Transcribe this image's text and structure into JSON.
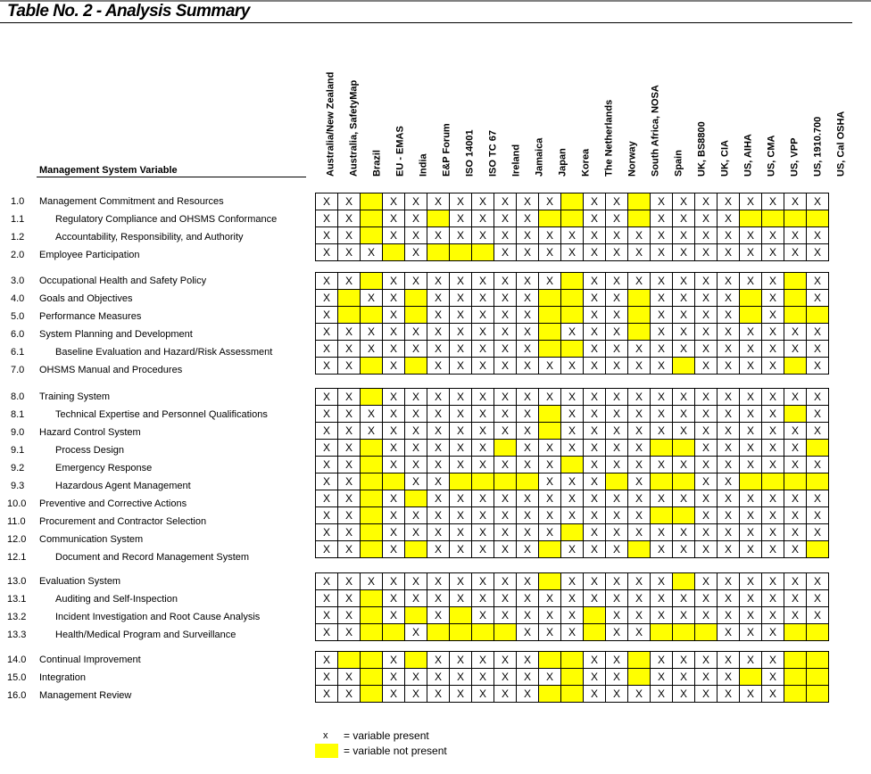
{
  "title": "Table No. 2 - Analysis Summary",
  "variable_heading": "Management System Variable",
  "present_mark": "X",
  "colors": {
    "not_present": "#ffff00",
    "present_bg": "#ffffff"
  },
  "columns": [
    "Australia/New Zealand",
    "Australia, SafetyMap",
    "Brazil",
    "EU - EMAS",
    "India",
    "E&P Forum",
    "ISO 14001",
    "ISO TC 67",
    "Ireland",
    "Jamaica",
    "Japan",
    "Korea",
    "The Netherlands",
    "Norway",
    "South Africa, NOSA",
    "Spain",
    "UK, BS8800",
    "UK, CIA",
    "US, AIHA",
    "US, CMA",
    "US, VPP",
    "US, 1910.700",
    "US, Cal OSHA"
  ],
  "groups": [
    {
      "rows": [
        {
          "num": "1.0",
          "label": "Management Commitment and Resources",
          "indent": false,
          "not_present": [
            2,
            11,
            14
          ]
        },
        {
          "num": "1.1",
          "label": "Regulatory Compliance and OHSMS Conformance",
          "indent": true,
          "not_present": [
            2,
            5,
            10,
            11,
            14,
            19,
            20,
            21,
            22
          ]
        },
        {
          "num": "1.2",
          "label": "Accountability, Responsibility, and Authority",
          "indent": true,
          "not_present": [
            2
          ]
        },
        {
          "num": "2.0",
          "label": "Employee Participation",
          "indent": false,
          "not_present": [
            3,
            5,
            6,
            7
          ]
        }
      ]
    },
    {
      "rows": [
        {
          "num": "3.0",
          "label": "Occupational Health and Safety Policy",
          "indent": false,
          "not_present": [
            2,
            11,
            21
          ]
        },
        {
          "num": "4.0",
          "label": "Goals and Objectives",
          "indent": false,
          "not_present": [
            1,
            4,
            10,
            11,
            14,
            19,
            21
          ]
        },
        {
          "num": "5.0",
          "label": "Performance Measures",
          "indent": false,
          "not_present": [
            1,
            2,
            4,
            10,
            11,
            14,
            19,
            21,
            22
          ]
        },
        {
          "num": "6.0",
          "label": "System Planning and Development",
          "indent": false,
          "not_present": [
            10,
            14
          ]
        },
        {
          "num": "6.1",
          "label": "Baseline Evaluation and Hazard/Risk Assessment",
          "indent": true,
          "not_present": [
            10,
            11
          ]
        },
        {
          "num": "7.0",
          "label": "OHSMS Manual and Procedures",
          "indent": false,
          "not_present": [
            2,
            4,
            16,
            21
          ]
        }
      ]
    },
    {
      "rows": [
        {
          "num": "8.0",
          "label": "Training System",
          "indent": false,
          "not_present": [
            2
          ]
        },
        {
          "num": "8.1",
          "label": "Technical Expertise and Personnel Qualifications",
          "indent": true,
          "not_present": [
            10,
            21
          ]
        },
        {
          "num": "9.0",
          "label": "Hazard Control System",
          "indent": false,
          "not_present": [
            10
          ]
        },
        {
          "num": "9.1",
          "label": "Process Design",
          "indent": true,
          "not_present": [
            2,
            8,
            15,
            16,
            22
          ]
        },
        {
          "num": "9.2",
          "label": "Emergency Response",
          "indent": true,
          "not_present": [
            2,
            11
          ]
        },
        {
          "num": "9.3",
          "label": "Hazardous Agent Management",
          "indent": true,
          "not_present": [
            2,
            3,
            6,
            7,
            8,
            9,
            13,
            15,
            16,
            19,
            20,
            21,
            22
          ]
        },
        {
          "num": "10.0",
          "label": "Preventive and Corrective Actions",
          "indent": false,
          "not_present": [
            2,
            4
          ]
        },
        {
          "num": "11.0",
          "label": "Procurement and Contractor Selection",
          "indent": false,
          "not_present": [
            2,
            15,
            16
          ]
        },
        {
          "num": "12.0",
          "label": "Communication System",
          "indent": false,
          "not_present": [
            2,
            11
          ]
        },
        {
          "num": "12.1",
          "label": "Document and Record Management System",
          "indent": true,
          "not_present": [
            2,
            4,
            10,
            14,
            22
          ]
        }
      ]
    },
    {
      "rows": [
        {
          "num": "13.0",
          "label": "Evaluation System",
          "indent": false,
          "not_present": [
            10,
            16
          ]
        },
        {
          "num": "13.1",
          "label": "Auditing and Self-Inspection",
          "indent": true,
          "not_present": [
            2
          ]
        },
        {
          "num": "13.2",
          "label": "Incident Investigation and Root Cause Analysis",
          "indent": true,
          "not_present": [
            2,
            4,
            6,
            12
          ]
        },
        {
          "num": "13.3",
          "label": "Health/Medical Program and Surveillance",
          "indent": true,
          "not_present": [
            2,
            3,
            5,
            6,
            7,
            8,
            12,
            15,
            16,
            17,
            21,
            22
          ]
        }
      ]
    },
    {
      "rows": [
        {
          "num": "14.0",
          "label": "Continual Improvement",
          "indent": false,
          "not_present": [
            1,
            2,
            4,
            10,
            11,
            14,
            21,
            22
          ]
        },
        {
          "num": "15.0",
          "label": "Integration",
          "indent": false,
          "not_present": [
            2,
            11,
            14,
            19,
            21,
            22
          ]
        },
        {
          "num": "16.0",
          "label": "Management Review",
          "indent": false,
          "not_present": [
            2,
            10,
            11,
            21,
            22
          ]
        }
      ]
    }
  ],
  "legend": {
    "present_symbol": "x",
    "present_text": "= variable present",
    "not_present_text": "= variable not present"
  }
}
